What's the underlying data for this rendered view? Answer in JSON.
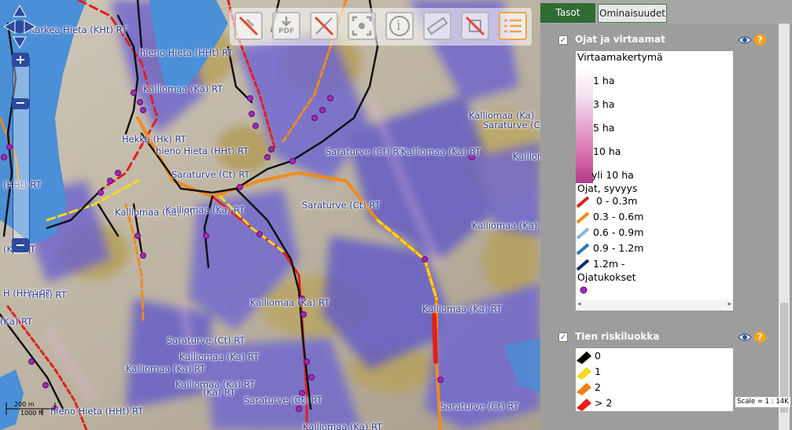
{
  "map": {
    "labels": [
      {
        "id": "lbl-1",
        "text": "Karkea Hieta (KHt) RT"
      },
      {
        "id": "lbl-2",
        "text": "hieno Hieta (HHt) RT"
      },
      {
        "id": "lbl-3",
        "text": "Kalliomaa (Ka) RT"
      },
      {
        "id": "lbl-4",
        "text": "Hekka (Hk) RT"
      },
      {
        "id": "lbl-5",
        "text": "hieno Hieta (HHt) RT"
      },
      {
        "id": "lbl-6",
        "text": "Saraturve (Ct) RT"
      },
      {
        "id": "lbl-7",
        "text": "Saraturve (Ct) RT"
      },
      {
        "id": "lbl-8",
        "text": "Kalliomaa (Ka) RT"
      },
      {
        "id": "lbl-9",
        "text": "Kalliomaa (Ka) RT"
      },
      {
        "id": "lbl-10",
        "text": "Saraturve (Ct) RT"
      },
      {
        "id": "lbl-11",
        "text": "Saraturve (Ct) RT"
      },
      {
        "id": "lbl-12",
        "text": "Kalliomaa (Ka) RT"
      },
      {
        "id": "lbl-13",
        "text": "Kalliomaa (Ka)"
      },
      {
        "id": "lbl-14",
        "text": "Saraturve (Ct)"
      },
      {
        "id": "lbl-15",
        "text": "Kalliomaa (Ka) RT"
      },
      {
        "id": "lbl-16",
        "text": "(Ka) RT"
      },
      {
        "id": "lbl-17",
        "text": "(HHt) RT"
      },
      {
        "id": "lbl-18",
        "text": "Kalliomaa (Ka) RT"
      },
      {
        "id": "lbl-19",
        "text": "Saraturve (Ct) RT"
      },
      {
        "id": "lbl-20",
        "text": "Kalliomaa (Ka) RT"
      },
      {
        "id": "lbl-21",
        "text": "Kalliomaa (Ka) RT"
      },
      {
        "id": "lbl-22",
        "text": "Kalliomaa (Ka) RT"
      },
      {
        "id": "lbl-23",
        "text": "Saraturve (Ct) RT"
      },
      {
        "id": "lbl-24",
        "text": "(Ka) RT"
      },
      {
        "id": "lbl-25",
        "text": "hieno Hieta (HHt) RT"
      },
      {
        "id": "lbl-26",
        "text": "Kalliomaa (Ka) RT"
      },
      {
        "id": "lbl-27",
        "text": "H (HHt) RT"
      },
      {
        "id": "lbl-28",
        "text": "Kalliomaa (Ka) RT"
      },
      {
        "id": "lbl-29",
        "text": "(HHt) RT"
      },
      {
        "id": "lbl-30",
        "text": "(Ka) RT"
      },
      {
        "id": "lbl-31",
        "text": "Kalliomaa (Ka) RT"
      }
    ],
    "toolbar": {
      "pdf_label": "PDF",
      "info_label": "i"
    },
    "zoom": {
      "plus": "+",
      "minus": "−"
    },
    "scalebar": {
      "top": "200 m",
      "bottom": "1000 ft"
    }
  },
  "panel": {
    "tabs": {
      "layers": "Tasot",
      "properties": "Ominaisuudet"
    },
    "layer1": {
      "name": "Ojat ja virtaamat",
      "checked": "✓",
      "legend": {
        "title": "Virtaamakertymä",
        "flow": [
          "1 ha",
          "3 ha",
          "5 ha",
          "10 ha",
          "yli 10 ha"
        ],
        "depth_title": "Ojat, syvyys",
        "depth": [
          {
            "label": "0 - 0.3m",
            "color": "#e0201b"
          },
          {
            "label": "0.3 - 0.6m",
            "color": "#ef8a1e"
          },
          {
            "label": "0.6 - 0.9m",
            "color": "#86b6d8"
          },
          {
            "label": "0.9 - 1.2m",
            "color": "#2f78b4"
          },
          {
            "label": "1.2m -",
            "color": "#0f2e63"
          }
        ],
        "ojatukokset": "Ojatukokset"
      }
    },
    "layer2": {
      "name": "Tien riskiluokka",
      "checked": "✓",
      "legend": [
        {
          "label": "0",
          "color": "#000000"
        },
        {
          "label": "1",
          "color": "#f6d91c"
        },
        {
          "label": "2",
          "color": "#f57e16"
        },
        {
          "label": "> 2",
          "color": "#ed1c17"
        }
      ]
    },
    "help": "?",
    "scale": "Scale = 1 : 14K"
  },
  "colors": {
    "accent_green": "#2f6b33",
    "water": "#4b8fd6",
    "purple_overlay": "#5b55c8",
    "help_orange": "#f4a21b"
  }
}
